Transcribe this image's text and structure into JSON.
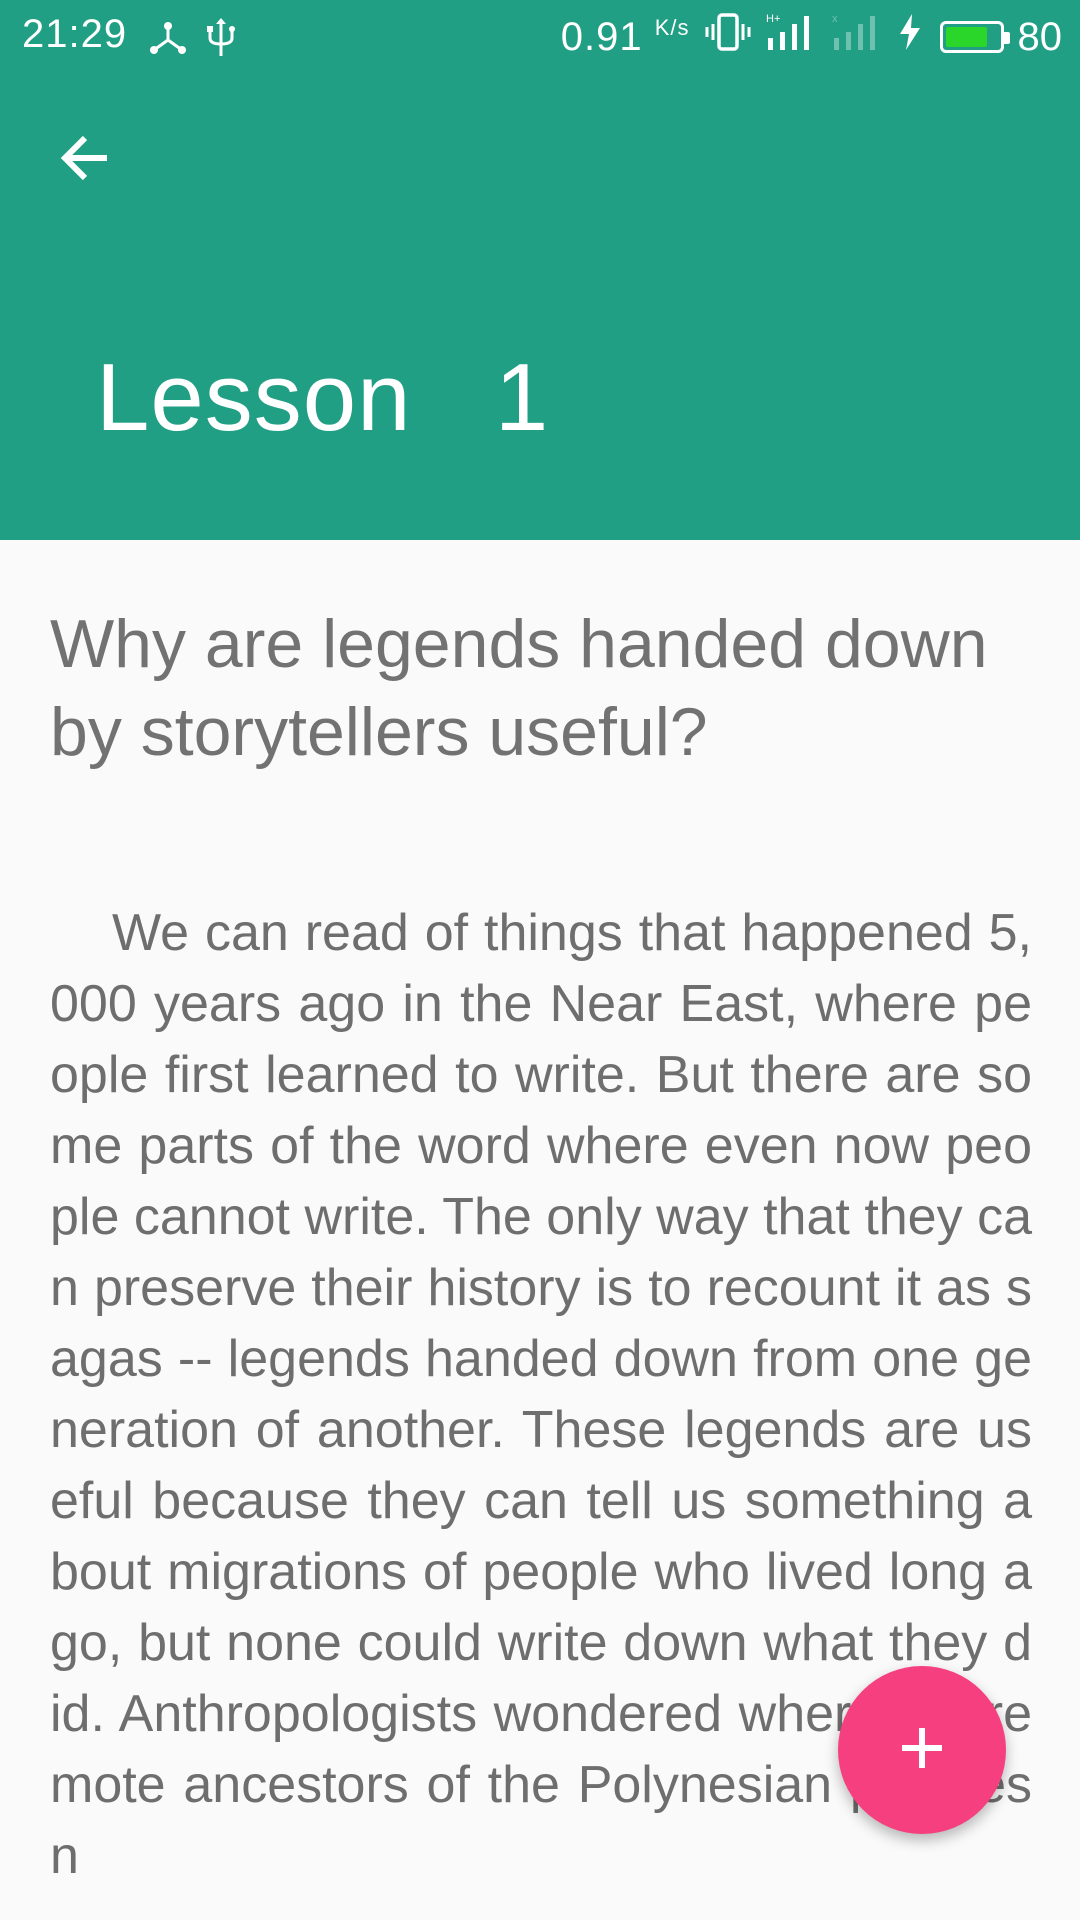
{
  "colors": {
    "primary": "#219F84",
    "accent": "#F63F7E",
    "background": "#FAFAFA",
    "battery": "#2BD62B"
  },
  "status_bar": {
    "time": "21:29",
    "net_speed": "0.91",
    "net_unit": "K/s",
    "battery_level": "80",
    "battery_fraction": 0.8,
    "icons": [
      "connection-icon",
      "usb-icon",
      "vibrate-icon",
      "signal-h-icon",
      "signal-empty-icon",
      "charging-icon",
      "battery-icon"
    ]
  },
  "toolbar": {
    "back_icon": "arrow-left-icon",
    "title": "Lesson  1"
  },
  "lesson": {
    "question": "Why are legends handed down by storytellers useful?",
    "passage": "We can read of things that happened 5,000 years ago in the Near East, where people first learned to write. But there are some parts of the word where even now people cannot write. The only way that they can preserve their history is to recount it as sagas -- legends handed down from one generation of another. These legends are useful because they can tell us something about migrations of people who lived long ago, but none could write down what they did. Anthropologists wondered where the remote ancestors of the Polynesian peoples n"
  },
  "fab": {
    "icon": "plus-icon"
  }
}
